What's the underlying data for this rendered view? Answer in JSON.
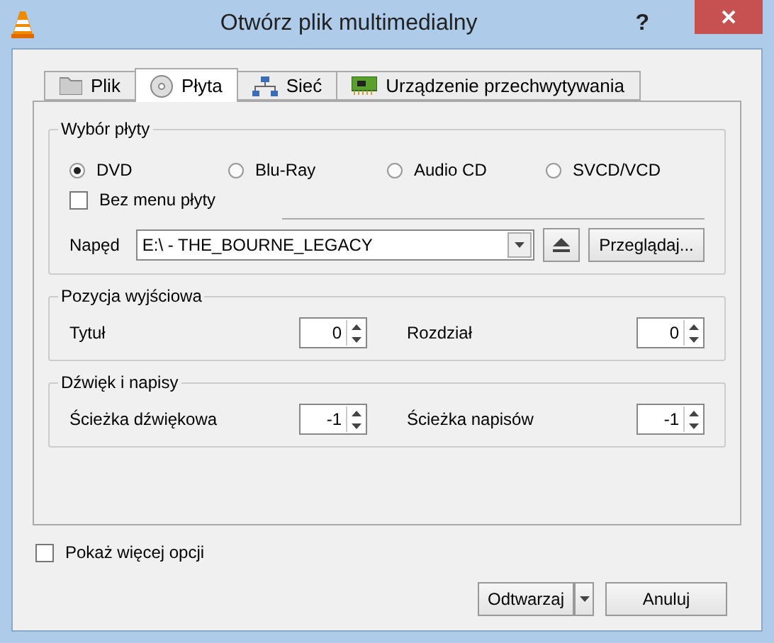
{
  "window": {
    "title": "Otwórz plik multimedialny",
    "help": "?"
  },
  "tabs": [
    {
      "label": "Plik",
      "kind": "folder",
      "selected": false
    },
    {
      "label": "Płyta",
      "kind": "disc",
      "selected": true
    },
    {
      "label": "Sieć",
      "kind": "network",
      "selected": false
    },
    {
      "label": "Urządzenie przechwytywania",
      "kind": "card",
      "selected": false
    }
  ],
  "disc_selection": {
    "title": "Wybór płyty",
    "options": [
      {
        "label": "DVD",
        "selected": true
      },
      {
        "label": "Blu-Ray",
        "selected": false
      },
      {
        "label": "Audio CD",
        "selected": false
      },
      {
        "label": "SVCD/VCD",
        "selected": false
      }
    ],
    "no_menu": {
      "label": "Bez menu płyty",
      "checked": false
    },
    "drive_label": "Napęd",
    "drive_value": "E:\\ - THE_BOURNE_LEGACY",
    "browse": "Przeglądaj..."
  },
  "start_position": {
    "title": "Pozycja wyjściowa",
    "fields": [
      {
        "label": "Tytuł",
        "value": "0"
      },
      {
        "label": "Rozdział",
        "value": "0"
      }
    ]
  },
  "audio_subtitles": {
    "title": "Dźwięk i napisy",
    "fields": [
      {
        "label": "Ścieżka dźwiękowa",
        "value": "-1"
      },
      {
        "label": "Ścieżka napisów",
        "value": "-1"
      }
    ]
  },
  "more_options": {
    "label": "Pokaż więcej opcji",
    "checked": false
  },
  "buttons": {
    "play": "Odtwarzaj",
    "cancel": "Anuluj"
  }
}
